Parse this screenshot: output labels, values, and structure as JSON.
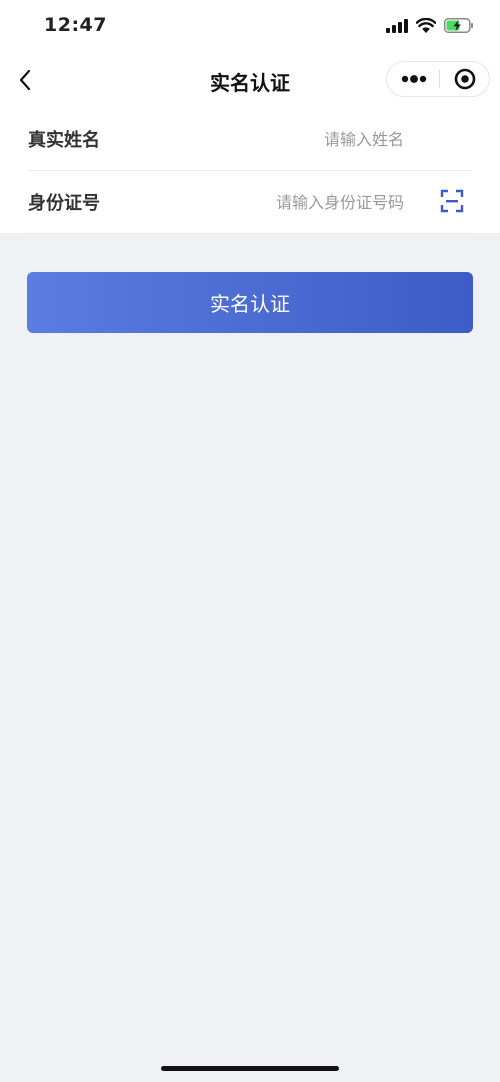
{
  "status_bar": {
    "time": "12:47",
    "icons": [
      "cellular-signal-icon",
      "wifi-icon",
      "battery-charging-icon"
    ]
  },
  "nav": {
    "title": "实名认证",
    "back_icon": "chevron-left-icon",
    "capsule_icons": [
      "more-dots-icon",
      "close-circle-icon"
    ]
  },
  "form": {
    "name_label": "真实姓名",
    "name_placeholder": "请输入姓名",
    "name_value": "",
    "id_label": "身份证号",
    "id_placeholder": "请输入身份证号码",
    "id_value": "",
    "scan_icon": "scan-icon"
  },
  "submit": {
    "label": "实名认证"
  },
  "colors": {
    "accent_start": "#5b7ce0",
    "accent_end": "#3e5cc7",
    "page_background": "#f0f1f5",
    "battery_green": "#4cd964"
  }
}
